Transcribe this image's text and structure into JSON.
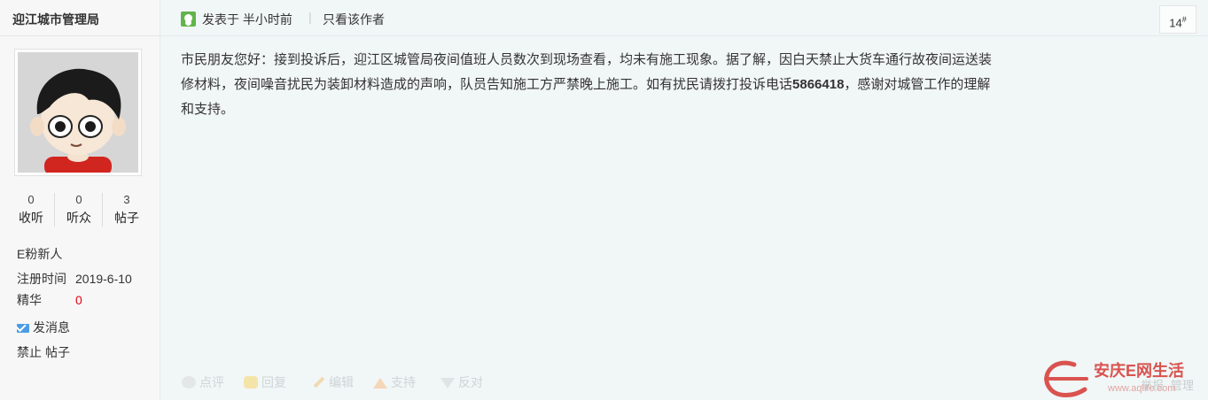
{
  "author": {
    "name": "迎江城市管理局",
    "stats": [
      {
        "num": "0",
        "label": "收听"
      },
      {
        "num": "0",
        "label": "听众"
      },
      {
        "num": "3",
        "label": "帖子"
      }
    ],
    "level": "E粉新人",
    "reg_label": "注册时间",
    "reg_date": "2019-6-10",
    "digest_label": "精华",
    "digest_value": "0",
    "message_label": "发消息",
    "ban_label": "禁止",
    "posts_label": "帖子"
  },
  "post": {
    "posted_prefix": "发表于",
    "posted_time": "半小时前",
    "separator": "|",
    "only_author": "只看该作者",
    "floor": "14",
    "floor_mark": "#",
    "content_part1": "市民朋友您好：接到投诉后，迎江区城管局夜间值班人员数次到现场查看，均未有施工现象。据了解，因白天禁止大货车通行故夜间运送装修材料，夜间噪音扰民为装卸材料造成的声响，队员告知施工方严禁晚上施工。如有扰民请拨打投诉电话",
    "content_phone": "5866418",
    "content_part2": "，感谢对城管工作的理解和支持。"
  },
  "actions": {
    "comment": "点评",
    "reply": "回复",
    "edit": "编辑",
    "support": "支持",
    "oppose": "反对",
    "report": "举报",
    "manage": "管理"
  },
  "watermark": {
    "brand": "安庆E网生活",
    "url": "www.aqlife.com"
  },
  "colors": {
    "main_bg": "#f1f6f7",
    "sidebar_bg": "#f7f7f7",
    "digest_red": "#e60012",
    "watermark": "#d9534f"
  }
}
